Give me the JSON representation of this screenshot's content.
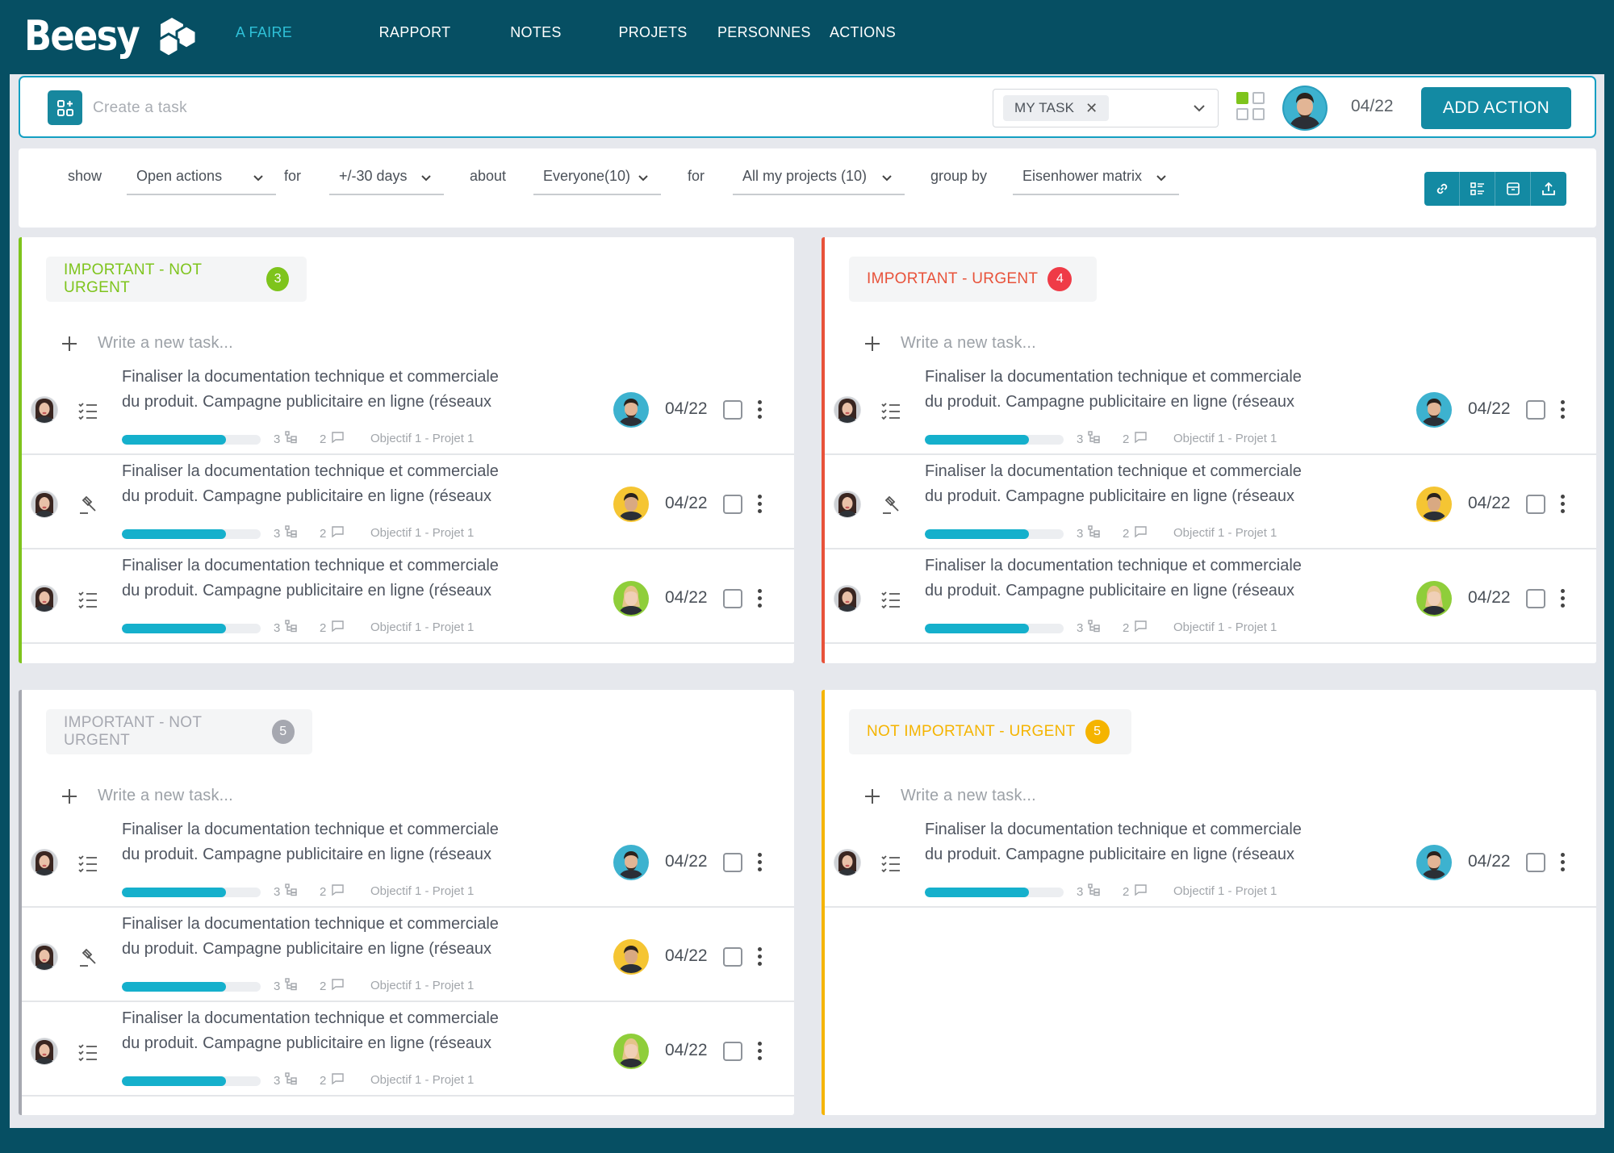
{
  "app": {
    "name": "Beesy"
  },
  "nav": {
    "items": [
      {
        "label": "A FAIRE",
        "active": true
      },
      {
        "label": "RAPPORT",
        "active": false
      },
      {
        "label": "NOTES",
        "active": false
      },
      {
        "label": "PROJETS",
        "active": false
      },
      {
        "label": "PERSONNES",
        "active": false
      },
      {
        "label": "ACTIONS",
        "active": false
      }
    ]
  },
  "taskbar": {
    "placeholder": "Create a task",
    "filter_chip": "MY TASK",
    "date": "04/22",
    "add_button": "ADD ACTION"
  },
  "filters": [
    {
      "label": "show",
      "value": "Open actions"
    },
    {
      "label": "for",
      "value": "+/-30 days"
    },
    {
      "label": "about",
      "value": "Everyone(10)"
    },
    {
      "label": "for",
      "value": "All my  projects (10)"
    },
    {
      "label": "group by",
      "value": "Eisenhower matrix"
    }
  ],
  "toolbar_icons": [
    "link-icon",
    "list-view-icon",
    "archive-icon",
    "export-icon"
  ],
  "colors": {
    "header_bg": "#064f63",
    "accent": "#138aa3",
    "progress": "#15b0cc",
    "green": "#7ec41c",
    "red": "#e8523a",
    "red_badge": "#ef3b47",
    "grey": "#a6a8b0",
    "yellow": "#f5b400"
  },
  "new_task_placeholder": "Write a new task...",
  "panels": [
    {
      "title": "IMPORTANT - NOT URGENT",
      "count": "3",
      "color": "#7ec41c",
      "badge_color": "#7ec41c",
      "border": "#7ec41c",
      "rows": [
        {
          "line1": "Finaliser la documentation technique et commerciale",
          "line2": "du produit.  Campagne publicitaire en ligne (réseaux",
          "type": "checklist-icon",
          "assignee": "man-teal",
          "date": "04/22",
          "subtasks": "3",
          "comments": "2",
          "objective": "Objectif 1 - Projet 1",
          "progress": 0.75
        },
        {
          "line1": "Finaliser la documentation technique et commerciale",
          "line2": "du produit.  Campagne publicitaire en ligne (réseaux",
          "type": "gavel-icon",
          "assignee": "man-yellow",
          "date": "04/22",
          "subtasks": "3",
          "comments": "2",
          "objective": "Objectif 1 - Projet 1",
          "progress": 0.75
        },
        {
          "line1": "Finaliser la documentation technique et commerciale",
          "line2": "du produit.  Campagne publicitaire en ligne (réseaux",
          "type": "checklist-icon",
          "assignee": "woman-green",
          "date": "04/22",
          "subtasks": "3",
          "comments": "2",
          "objective": "Objectif 1 - Projet 1",
          "progress": 0.75
        }
      ]
    },
    {
      "title": "IMPORTANT - URGENT",
      "count": "4",
      "color": "#e8523a",
      "badge_color": "#ef3b47",
      "border": "#e8523a",
      "rows": [
        {
          "line1": "Finaliser la documentation technique et commerciale",
          "line2": "du produit.  Campagne publicitaire en ligne (réseaux",
          "type": "checklist-icon",
          "assignee": "man-teal",
          "date": "04/22",
          "subtasks": "3",
          "comments": "2",
          "objective": "Objectif 1 - Projet 1",
          "progress": 0.75
        },
        {
          "line1": "Finaliser la documentation technique et commerciale",
          "line2": "du produit.  Campagne publicitaire en ligne (réseaux",
          "type": "gavel-icon",
          "assignee": "man-yellow",
          "date": "04/22",
          "subtasks": "3",
          "comments": "2",
          "objective": "Objectif 1 - Projet 1",
          "progress": 0.75
        },
        {
          "line1": "Finaliser la documentation technique et commerciale",
          "line2": "du produit.  Campagne publicitaire en ligne (réseaux",
          "type": "checklist-icon",
          "assignee": "woman-green",
          "date": "04/22",
          "subtasks": "3",
          "comments": "2",
          "objective": "Objectif 1 - Projet 1",
          "progress": 0.75
        }
      ]
    },
    {
      "title": "IMPORTANT - NOT URGENT",
      "count": "5",
      "color": "#a6a8b0",
      "badge_color": "#a6a8b0",
      "border": "#a6a8b0",
      "rows": [
        {
          "line1": "Finaliser la documentation technique et commerciale",
          "line2": "du produit.  Campagne publicitaire en ligne (réseaux",
          "type": "checklist-icon",
          "assignee": "man-teal",
          "date": "04/22",
          "subtasks": "3",
          "comments": "2",
          "objective": "Objectif 1 - Projet 1",
          "progress": 0.75
        },
        {
          "line1": "Finaliser la documentation technique et commerciale",
          "line2": "du produit.  Campagne publicitaire en ligne (réseaux",
          "type": "gavel-icon",
          "assignee": "man-yellow",
          "date": "04/22",
          "subtasks": "3",
          "comments": "2",
          "objective": "Objectif 1 - Projet 1",
          "progress": 0.75
        },
        {
          "line1": "Finaliser la documentation technique et commerciale",
          "line2": "du produit.  Campagne publicitaire en ligne (réseaux",
          "type": "checklist-icon",
          "assignee": "woman-green",
          "date": "04/22",
          "subtasks": "3",
          "comments": "2",
          "objective": "Objectif 1 - Projet 1",
          "progress": 0.75
        }
      ]
    },
    {
      "title": "NOT IMPORTANT - URGENT",
      "count": "5",
      "color": "#f5b400",
      "badge_color": "#f5b400",
      "border": "#f5b400",
      "rows": [
        {
          "line1": "Finaliser la documentation technique et commerciale",
          "line2": "du produit.  Campagne publicitaire en ligne (réseaux",
          "type": "checklist-icon",
          "assignee": "man-teal",
          "date": "04/22",
          "subtasks": "3",
          "comments": "2",
          "objective": "Objectif 1 - Projet 1",
          "progress": 0.75
        }
      ]
    }
  ]
}
